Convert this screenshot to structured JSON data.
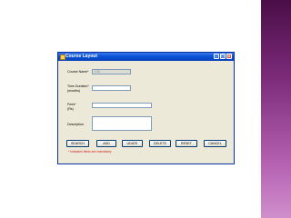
{
  "window": {
    "title": "Course Layout"
  },
  "form": {
    "course_name_label": "Course Name*",
    "course_name_value": "GDI",
    "time_duration_label_line1": "Time Duration*",
    "time_duration_label_line2": "(months)",
    "fees_label_line1": "Fees*",
    "fees_label_line2": "(Rs)",
    "description_label": "Description"
  },
  "buttons": {
    "search": "SEARCH",
    "add": "ADD",
    "update": "UDATE",
    "delete": "DELETE",
    "reset": "RESET",
    "cancel": "CANCEL"
  },
  "note": "* Indicates fields are mandatory",
  "colors": {
    "titlebar": "#0a52d8",
    "dialog_bg": "#ece9d8",
    "note_text": "#d42020",
    "side_bar": "#7a2a78"
  }
}
